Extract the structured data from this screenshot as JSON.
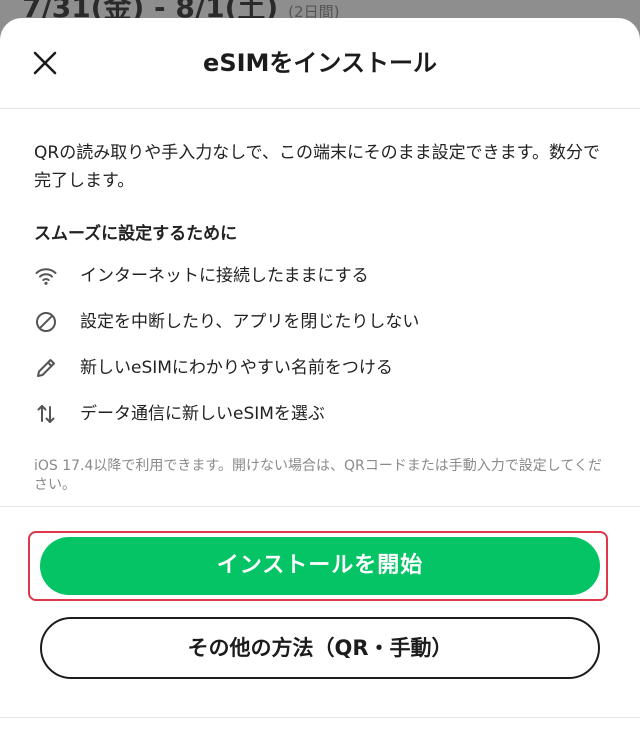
{
  "backdrop": {
    "date_range": "7/31(金) - 8/1(土)",
    "duration": "(2日間)"
  },
  "header": {
    "title": "eSIMをインストール"
  },
  "intro": {
    "text": "QRの読み取りや手入力なしで、この端末にそのまま設定できます。数分で完了します。"
  },
  "tips_section": {
    "title": "スムーズに設定するために",
    "items": [
      {
        "icon": "wifi-icon",
        "label": "インターネットに接続したままにする"
      },
      {
        "icon": "prohibited-icon",
        "label": "設定を中断したり、アプリを閉じたりしない"
      },
      {
        "icon": "pencil-icon",
        "label": "新しいeSIMにわかりやすい名前をつける"
      },
      {
        "icon": "swap-vertical-icon",
        "label": "データ通信に新しいeSIMを選ぶ"
      }
    ]
  },
  "note": {
    "text": "iOS 17.4以降で利用できます。開けない場合は、QRコードまたは手動入力で設定してください。"
  },
  "actions": {
    "primary_label": "インストールを開始",
    "secondary_label": "その他の方法（QR・手動）"
  },
  "colors": {
    "primary": "#05c465",
    "highlight": "#e0364a",
    "text": "#222222",
    "muted": "#8a8a8a"
  }
}
